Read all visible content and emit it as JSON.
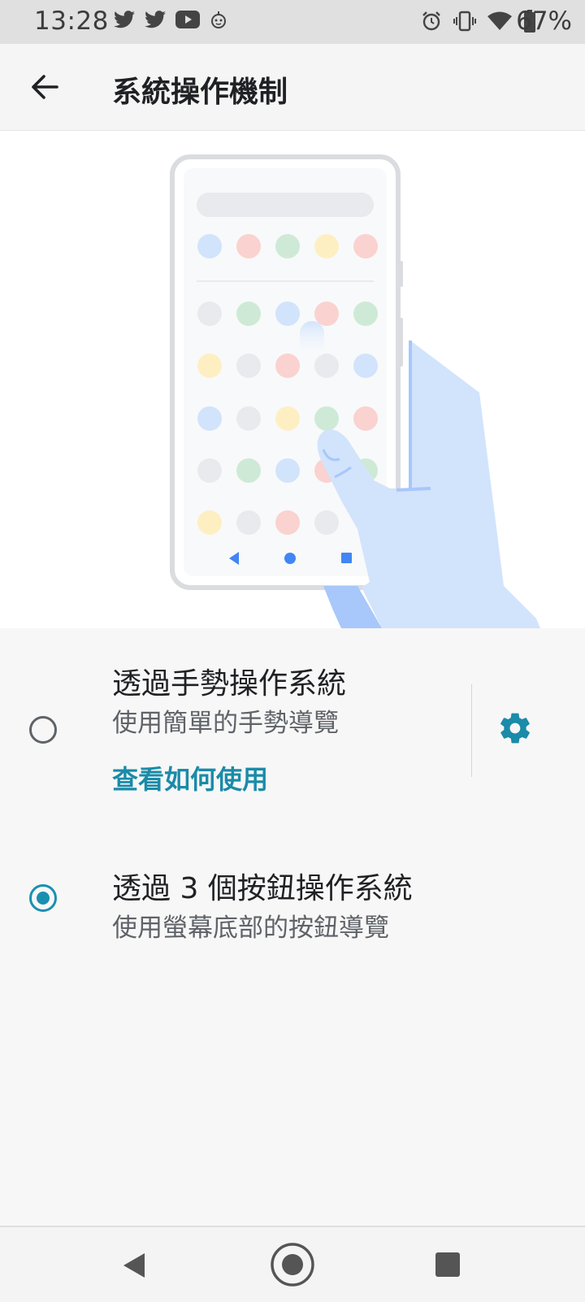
{
  "status_bar": {
    "time": "13:28",
    "battery_percent": "67%",
    "left_icons": [
      "twitter-icon",
      "twitter-icon",
      "youtube-icon",
      "robot-icon"
    ],
    "right_icons": [
      "alarm-icon",
      "vibrate-icon",
      "wifi-icon",
      "battery-icon"
    ]
  },
  "app_bar": {
    "title": "系統操作機制",
    "back_icon": "arrow-back-icon"
  },
  "options": [
    {
      "title": "透過手勢操作系統",
      "subtitle": "使用簡單的手勢導覽",
      "link": "查看如何使用",
      "selected": false,
      "settings_icon": "gear-icon"
    },
    {
      "title": "透過 3 個按鈕操作系統",
      "subtitle": "使用螢幕底部的按鈕導覽",
      "selected": true
    }
  ],
  "colors": {
    "accent": "#1a90b0",
    "link": "#1a8ba8"
  },
  "nav_bar": {
    "icons": [
      "nav-back-icon",
      "nav-home-icon",
      "nav-recents-icon"
    ]
  }
}
